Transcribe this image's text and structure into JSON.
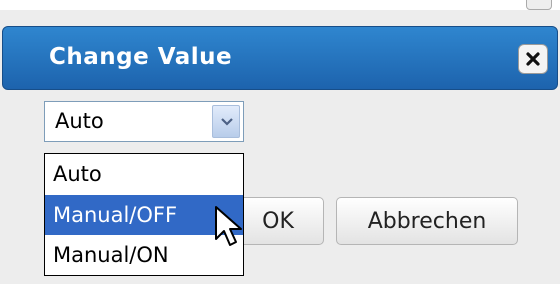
{
  "dialog": {
    "title": "Change Value",
    "close_icon": "close-icon"
  },
  "select": {
    "value": "Auto",
    "arrow_icon": "chevron-down-icon",
    "options": [
      {
        "label": "Auto",
        "selected": false
      },
      {
        "label": "Manual/OFF",
        "selected": true
      },
      {
        "label": "Manual/ON",
        "selected": false
      }
    ]
  },
  "buttons": {
    "ok_label": "OK",
    "cancel_label": "Abbrechen"
  },
  "colors": {
    "titlebar": "#1d63ad",
    "selection": "#3169c6"
  }
}
